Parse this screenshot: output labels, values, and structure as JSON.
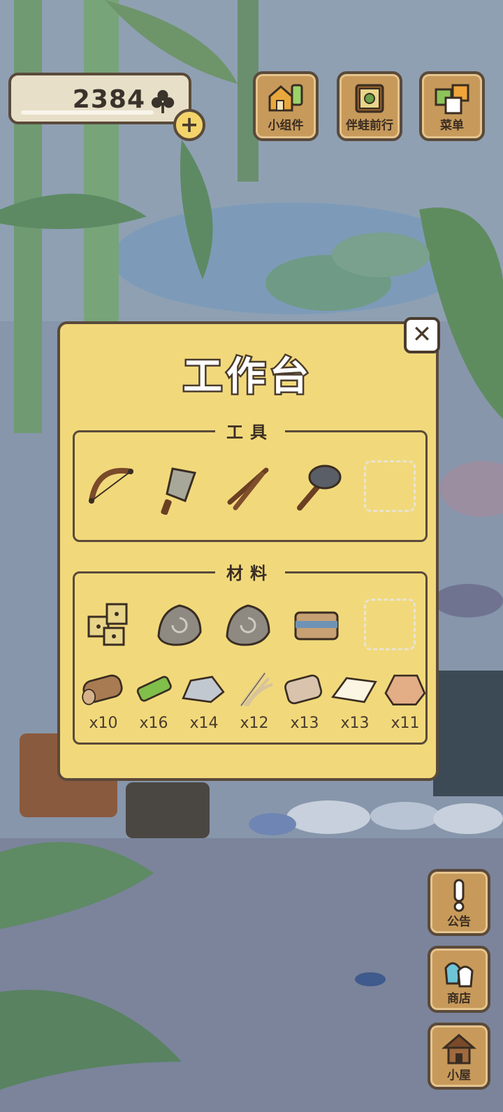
{
  "hud": {
    "clover_count": "2384",
    "add_symbol": "+",
    "top_buttons": [
      {
        "label": "小组件",
        "icon": "widget-icon"
      },
      {
        "label": "伴蛙前行",
        "icon": "companion-book-icon"
      },
      {
        "label": "菜单",
        "icon": "menu-cards-icon"
      }
    ],
    "side_buttons": [
      {
        "label": "公告",
        "icon": "exclamation-icon"
      },
      {
        "label": "商店",
        "icon": "shop-bags-icon"
      },
      {
        "label": "小屋",
        "icon": "house-icon"
      }
    ]
  },
  "workbench": {
    "title": "工作台",
    "close_symbol": "✕",
    "tools": {
      "title": "工具",
      "items": [
        {
          "name": "bow-icon"
        },
        {
          "name": "brush-icon"
        },
        {
          "name": "sticks-icon"
        },
        {
          "name": "stone-hammer-icon"
        }
      ]
    },
    "materials": {
      "title": "材料",
      "items_row1": [
        {
          "name": "dice-icon"
        },
        {
          "name": "spiral-stone-icon"
        },
        {
          "name": "spiral-stone-icon"
        },
        {
          "name": "cloth-bundle-icon"
        }
      ],
      "items_row2": [
        {
          "name": "log-icon",
          "qty": "x10"
        },
        {
          "name": "bamboo-icon",
          "qty": "x16"
        },
        {
          "name": "stone-icon",
          "qty": "x14"
        },
        {
          "name": "fiber-icon",
          "qty": "x12"
        },
        {
          "name": "leather-icon",
          "qty": "x13"
        },
        {
          "name": "paper-icon",
          "qty": "x13"
        },
        {
          "name": "clay-icon",
          "qty": "x11"
        }
      ]
    }
  },
  "colors": {
    "panel": "#f1d97b",
    "border": "#5a4a3a",
    "wood": "#c79a5b"
  }
}
